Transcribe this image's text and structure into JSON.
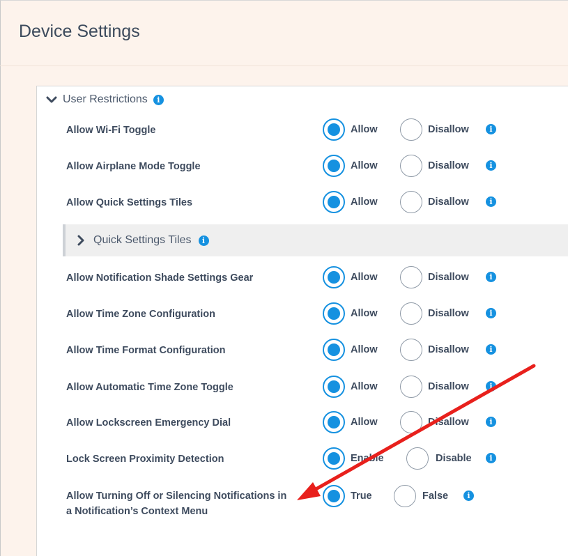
{
  "page": {
    "title": "Device Settings"
  },
  "section": {
    "title": "User Restrictions"
  },
  "subgroup": {
    "title": "Quick Settings Tiles"
  },
  "rows": [
    {
      "label": "Allow Wi-Fi Toggle",
      "option1": "Allow",
      "option2": "Disallow",
      "selected": "option1"
    },
    {
      "label": "Allow Airplane Mode Toggle",
      "option1": "Allow",
      "option2": "Disallow",
      "selected": "option1"
    },
    {
      "label": "Allow Quick Settings Tiles",
      "option1": "Allow",
      "option2": "Disallow",
      "selected": "option1"
    },
    {
      "label": "Allow Notification Shade Settings Gear",
      "option1": "Allow",
      "option2": "Disallow",
      "selected": "option1"
    },
    {
      "label": "Allow Time Zone Configuration",
      "option1": "Allow",
      "option2": "Disallow",
      "selected": "option1"
    },
    {
      "label": "Allow Time Format Configuration",
      "option1": "Allow",
      "option2": "Disallow",
      "selected": "option1"
    },
    {
      "label": "Allow Automatic Time Zone Toggle",
      "option1": "Allow",
      "option2": "Disallow",
      "selected": "option1"
    },
    {
      "label": "Allow Lockscreen Emergency Dial",
      "option1": "Allow",
      "option2": "Disallow",
      "selected": "option1"
    },
    {
      "label": "Lock Screen Proximity Detection",
      "option1": "Enable",
      "option2": "Disable",
      "selected": "option1"
    },
    {
      "label": "Allow Turning Off or Silencing Notifications in a Notification’s Context Menu",
      "option1": "True",
      "option2": "False",
      "selected": "option1"
    }
  ],
  "icons": {
    "info": "info-icon",
    "chevron_down": "chevron-down-icon",
    "chevron_right": "chevron-right-icon"
  },
  "colors": {
    "accent": "#1591e0",
    "annotation_arrow": "#e8201c",
    "page_background": "#fdf3ec"
  }
}
